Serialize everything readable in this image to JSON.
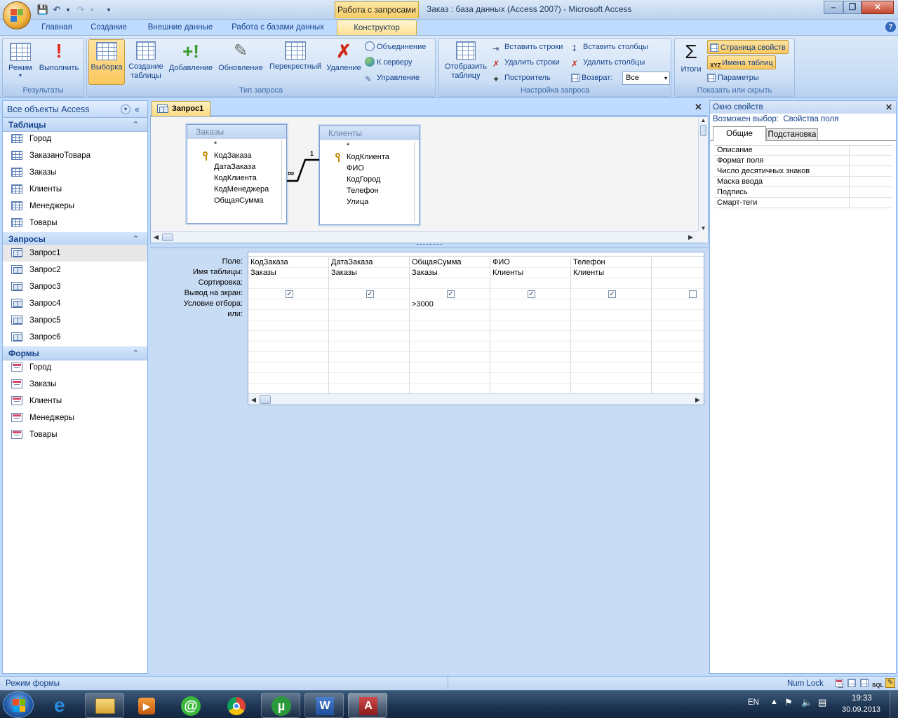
{
  "window": {
    "title": "Заказ : база данных (Access 2007)  -  Microsoft Access",
    "context_tab": "Работа с запросами"
  },
  "ribbon_tabs": [
    "Главная",
    "Создание",
    "Внешние данные",
    "Работа с базами данных",
    "Конструктор"
  ],
  "ribbon": {
    "results": {
      "label": "Результаты",
      "mode": "Режим",
      "run": "Выполнить"
    },
    "query_type": {
      "label": "Тип запроса",
      "select": "Выборка",
      "make_table_1": "Создание",
      "make_table_2": "таблицы",
      "append": "Добавление",
      "update": "Обновление",
      "crosstab": "Перекрестный",
      "delete": "Удаление",
      "union": "Объединение",
      "pass_through": "К серверу",
      "data_definition": "Управление"
    },
    "query_setup": {
      "label": "Настройка запроса",
      "show_table_1": "Отобразить",
      "show_table_2": "таблицу",
      "insert_rows": "Вставить строки",
      "delete_rows": "Удалить строки",
      "builder": "Построитель",
      "insert_columns": "Вставить столбцы",
      "delete_columns": "Удалить столбцы",
      "return_label": "Возврат:",
      "return_value": "Все"
    },
    "show_hide": {
      "label": "Показать или скрыть",
      "totals": "Итоги",
      "property_sheet": "Страница свойств",
      "table_names": "Имена таблиц",
      "parameters": "Параметры"
    }
  },
  "nav": {
    "header": "Все объекты Access",
    "sections": {
      "tables": {
        "title": "Таблицы",
        "items": [
          "Город",
          "ЗаказаноТовара",
          "Заказы",
          "Клиенты",
          "Менеджеры",
          "Товары"
        ]
      },
      "queries": {
        "title": "Запросы",
        "items": [
          "Запрос1",
          "Запрос2",
          "Запрос3",
          "Запрос4",
          "Запрос5",
          "Запрос6"
        ],
        "selected": 0
      },
      "forms": {
        "title": "Формы",
        "items": [
          "Город",
          "Заказы",
          "Клиенты",
          "Менеджеры",
          "Товары"
        ]
      }
    }
  },
  "document": {
    "tab": "Запрос1",
    "tables": [
      {
        "title": "Заказы",
        "fields": [
          "*",
          "КодЗаказа",
          "ДатаЗаказа",
          "КодКлиента",
          "КодМенеджера",
          "ОбщаяСумма"
        ],
        "key": 1
      },
      {
        "title": "Клиенты",
        "fields": [
          "*",
          "КодКлиента",
          "ФИО",
          "КодГород",
          "Телефон",
          "Улица"
        ],
        "key": 1
      }
    ],
    "relation": {
      "many": "∞",
      "one": "1"
    },
    "row_labels": [
      "Поле:",
      "Имя таблицы:",
      "Сортировка:",
      "Вывод на экран:",
      "Условие отбора:",
      "или:"
    ],
    "columns": [
      {
        "field": "КодЗаказа",
        "table": "Заказы",
        "show": true,
        "criteria": ""
      },
      {
        "field": "ДатаЗаказа",
        "table": "Заказы",
        "show": true,
        "criteria": ""
      },
      {
        "field": "ОбщаяСумма",
        "table": "Заказы",
        "show": true,
        "criteria": ">3000"
      },
      {
        "field": "ФИО",
        "table": "Клиенты",
        "show": true,
        "criteria": ""
      },
      {
        "field": "Телефон",
        "table": "Клиенты",
        "show": true,
        "criteria": ""
      },
      {
        "field": "",
        "table": "",
        "show": false,
        "criteria": ""
      }
    ]
  },
  "properties": {
    "title": "Окно свойств",
    "selection_label": "Возможен выбор:",
    "selection_value": "Свойства поля",
    "tab_general": "Общие",
    "tab_lookup": "Подстановка",
    "rows": [
      "Описание",
      "Формат поля",
      "Число десятичных знаков",
      "Маска ввода",
      "Подпись",
      "Смарт-теги"
    ]
  },
  "status": {
    "left": "Режим формы",
    "numlock": "Num Lock"
  },
  "taskbar": {
    "lang": "EN",
    "time": "19:33",
    "date": "30.09.2013"
  }
}
